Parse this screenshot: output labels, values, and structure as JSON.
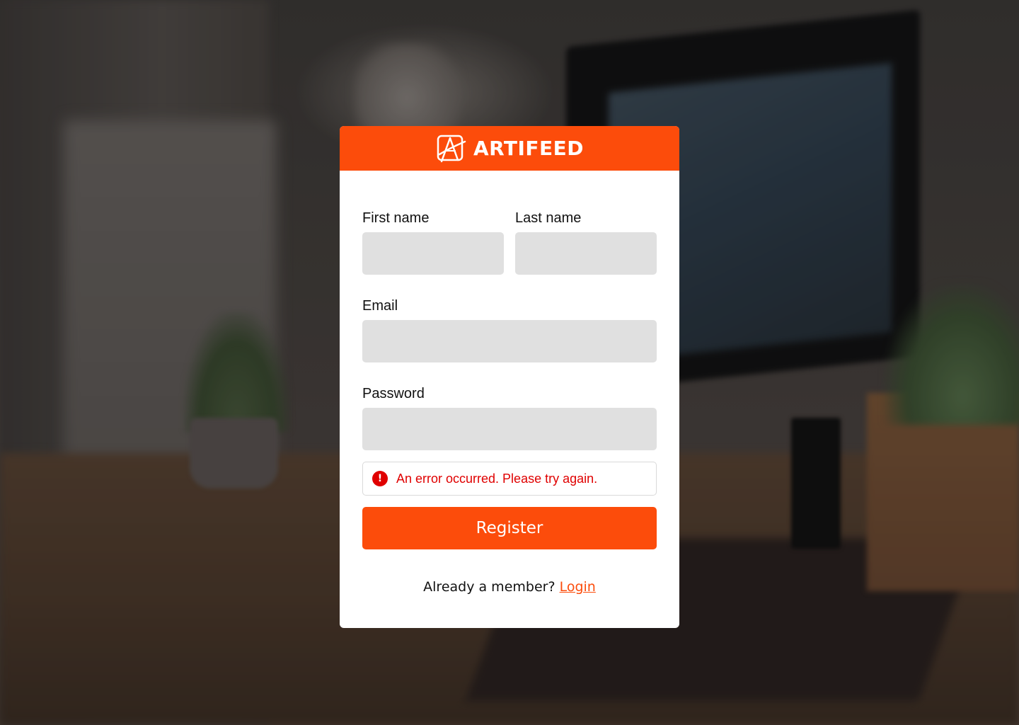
{
  "theme": {
    "brand_color": "#fc4c0b",
    "error_color": "#e00000"
  },
  "header": {
    "logo_icon": "artifeed-logo-icon",
    "brand_name": "ARTIFEED"
  },
  "form": {
    "first_name": {
      "label": "First name",
      "value": "",
      "placeholder": ""
    },
    "last_name": {
      "label": "Last name",
      "value": "",
      "placeholder": ""
    },
    "email": {
      "label": "Email",
      "value": "",
      "placeholder": ""
    },
    "password": {
      "label": "Password",
      "value": "",
      "placeholder": ""
    },
    "error": {
      "icon": "exclamation-icon",
      "message": "An error occurred. Please try again."
    },
    "submit_label": "Register"
  },
  "footer": {
    "prompt": "Already a member?",
    "login_label": "Login"
  }
}
